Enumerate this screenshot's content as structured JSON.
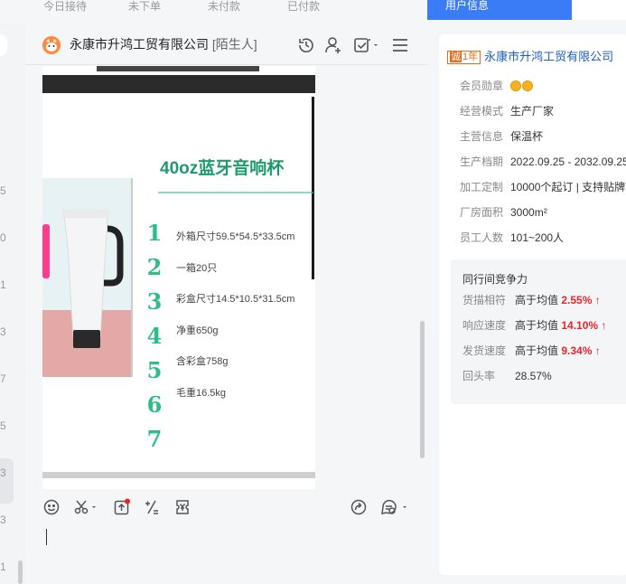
{
  "top_stats": [
    "今日接待",
    "未下单",
    "未付款",
    "已付款"
  ],
  "left_numbers": [
    "5",
    "0",
    "1",
    "3",
    "7",
    "5",
    "3",
    "3",
    "1"
  ],
  "chat": {
    "title": "永康市升鸿工贸有限公司",
    "tag": "[陌生人]",
    "header_icons": [
      "history-icon",
      "user-add-icon",
      "task-check-icon",
      "menu-icon"
    ],
    "product_image": {
      "title": "40oz蓝牙音响杯",
      "specs": [
        "外箱尺寸59.5*54.5*33.5cm",
        "一箱20只",
        "彩盒尺寸14.5*10.5*31.5cm",
        "净重650g",
        "含彩盒758g",
        "毛重16.5kg"
      ],
      "numbers": [
        "1",
        "2",
        "3",
        "4",
        "5",
        "6",
        "7"
      ]
    },
    "toolbar_icons": [
      "emoji-icon",
      "scissors-icon",
      "upload-icon",
      "calculator-icon",
      "coupon-icon",
      "share-icon",
      "quick-reply-icon"
    ]
  },
  "user_panel": {
    "tab_label": "用户信息",
    "company": "永康市升鸿工贸有限公司",
    "badge_prefix": "诚",
    "badge_years": "1年",
    "info": [
      {
        "label": "会员勋章",
        "value": ""
      },
      {
        "label": "经营模式",
        "value": "生产厂家"
      },
      {
        "label": "主营信息",
        "value": "保温杯"
      },
      {
        "label": "生产档期",
        "value": "2022.09.25 - 2032.09.25"
      },
      {
        "label": "加工定制",
        "value": "10000个起订 | 支持贴牌"
      },
      {
        "label": "厂房面积",
        "value": "3000m²"
      },
      {
        "label": "员工人数",
        "value": "101~200人"
      }
    ],
    "competition": {
      "title": "同行间竞争力",
      "rows": [
        {
          "label": "货描相符",
          "text": "高于均值",
          "pct": "2.55%",
          "arrow": "↑"
        },
        {
          "label": "响应速度",
          "text": "高于均值",
          "pct": "14.10%",
          "arrow": "↑"
        },
        {
          "label": "发货速度",
          "text": "高于均值",
          "pct": "9.34%",
          "arrow": "↑"
        },
        {
          "label": "回头率",
          "text": "28.57%",
          "pct": "",
          "arrow": ""
        }
      ]
    }
  }
}
